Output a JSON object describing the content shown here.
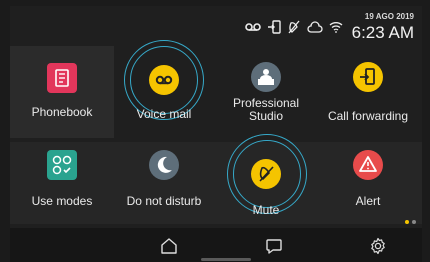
{
  "status_bar": {
    "date": "19 AGO 2019",
    "time": "6:23 AM",
    "icons": [
      "voicemail-status-icon",
      "call-forward-status-icon",
      "mute-status-icon",
      "cloud-icon",
      "wifi-icon"
    ]
  },
  "tiles": {
    "phonebook": {
      "label": "Phonebook",
      "icon": "phonebook-icon",
      "color": "#e2365b"
    },
    "voice_mail": {
      "label": "Voice mail",
      "icon": "voicemail-icon",
      "color": "#f5c400"
    },
    "professional_studio": {
      "label": "Professional Studio",
      "icon": "reception-desk-icon",
      "color": "#5e6e7a"
    },
    "call_forwarding": {
      "label": "Call forwarding",
      "icon": "call-forward-icon",
      "color": "#f5c400"
    },
    "use_modes": {
      "label": "Use modes",
      "icon": "use-modes-icon",
      "color": "#2aa38f"
    },
    "do_not_disturb": {
      "label": "Do not disturb",
      "icon": "moon-icon",
      "color": "#5e6e7a"
    },
    "mute": {
      "label": "Mute",
      "icon": "mute-icon",
      "color": "#f5c400"
    },
    "alert": {
      "label": "Alert",
      "icon": "alert-icon",
      "color": "#e84b4b"
    }
  },
  "navbar": {
    "items": [
      "home-icon",
      "message-icon",
      "settings-icon"
    ]
  },
  "page_indicator": {
    "pages": 2,
    "current": 1,
    "active_color": "#f5c400"
  }
}
